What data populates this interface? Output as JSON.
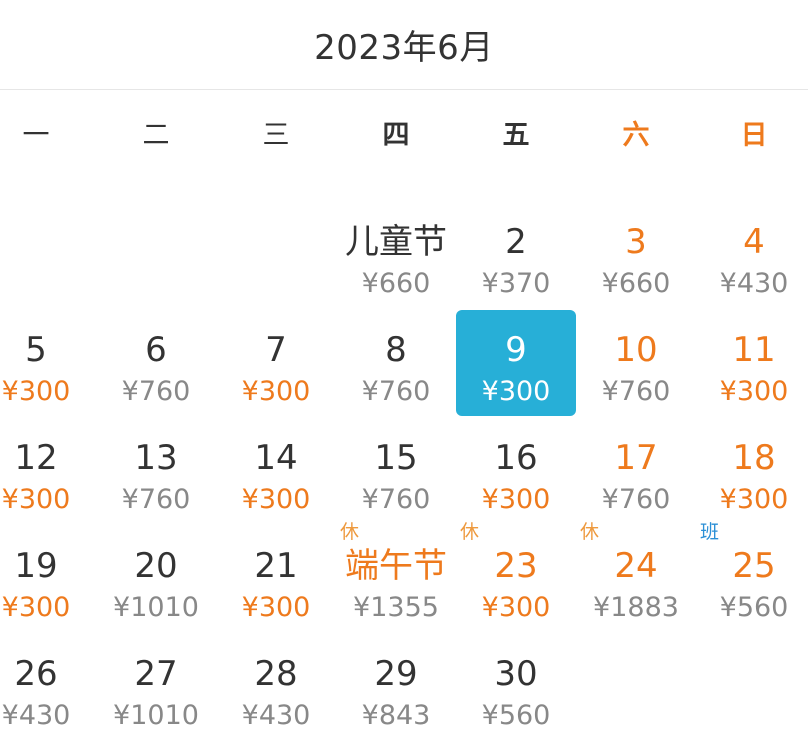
{
  "calendar": {
    "title": "2023年6月",
    "weekdays": [
      "一",
      "二",
      "三",
      "四",
      "五",
      "六",
      "日"
    ],
    "colors": {
      "accent": "#ee7a1d",
      "selected_bg": "#27afd7",
      "work_tag": "#2b8fd6"
    },
    "days": [
      {
        "label": "儿童节",
        "price": "¥660"
      },
      {
        "label": "2",
        "price": "¥370"
      },
      {
        "label": "3",
        "price": "¥660"
      },
      {
        "label": "4",
        "price": "¥430"
      },
      {
        "label": "5",
        "price": "¥300"
      },
      {
        "label": "6",
        "price": "¥760"
      },
      {
        "label": "7",
        "price": "¥300"
      },
      {
        "label": "8",
        "price": "¥760"
      },
      {
        "label": "9",
        "price": "¥300"
      },
      {
        "label": "10",
        "price": "¥760"
      },
      {
        "label": "11",
        "price": "¥300"
      },
      {
        "label": "12",
        "price": "¥300"
      },
      {
        "label": "13",
        "price": "¥760"
      },
      {
        "label": "14",
        "price": "¥300"
      },
      {
        "label": "15",
        "price": "¥760"
      },
      {
        "label": "16",
        "price": "¥300"
      },
      {
        "label": "17",
        "price": "¥760"
      },
      {
        "label": "18",
        "price": "¥300"
      },
      {
        "label": "19",
        "price": "¥300"
      },
      {
        "label": "20",
        "price": "¥1010"
      },
      {
        "label": "21",
        "price": "¥300"
      },
      {
        "label": "端午节",
        "price": "¥1355",
        "tag": "休"
      },
      {
        "label": "23",
        "price": "¥300",
        "tag": "休"
      },
      {
        "label": "24",
        "price": "¥1883",
        "tag": "休"
      },
      {
        "label": "25",
        "price": "¥560",
        "tag": "班"
      },
      {
        "label": "26",
        "price": "¥430"
      },
      {
        "label": "27",
        "price": "¥1010"
      },
      {
        "label": "28",
        "price": "¥430"
      },
      {
        "label": "29",
        "price": "¥843"
      },
      {
        "label": "30",
        "price": "¥560"
      }
    ]
  }
}
